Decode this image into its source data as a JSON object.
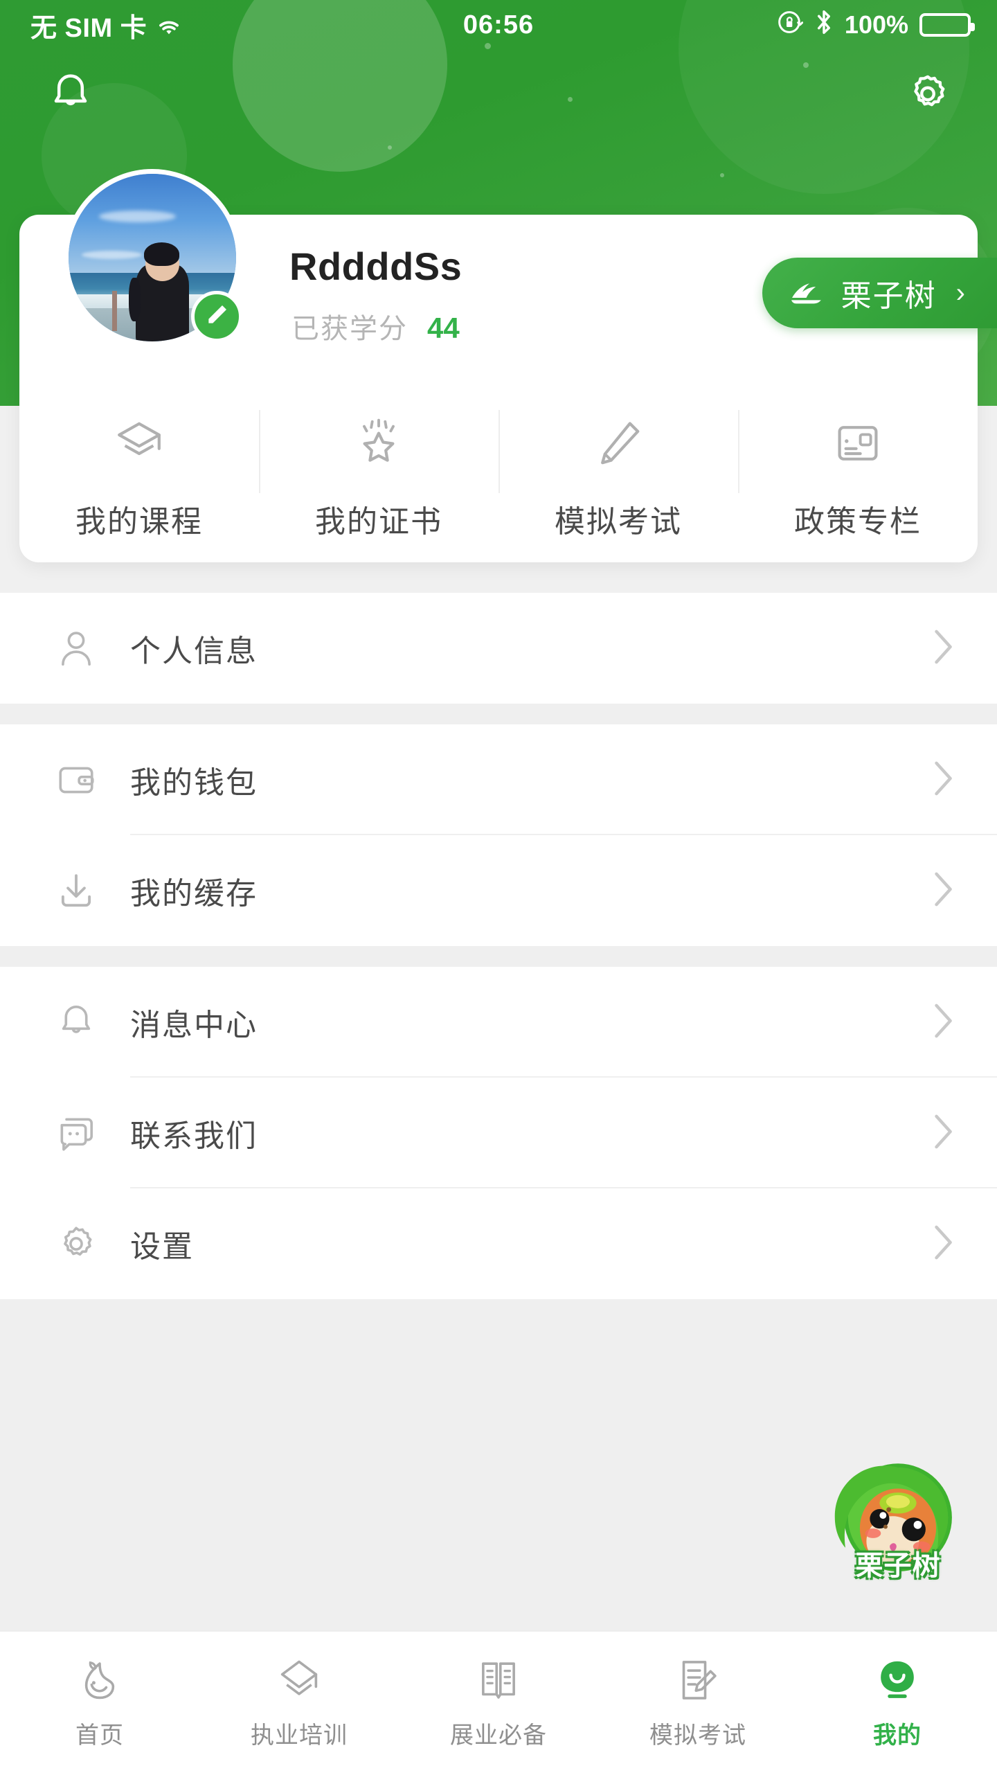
{
  "status_bar": {
    "carrier": "无 SIM 卡",
    "wifi_icon": "wifi-icon",
    "time": "06:56",
    "rotation_lock_icon": "rotation-lock-icon",
    "bluetooth_icon": "bluetooth-icon",
    "battery_percent": "100%",
    "battery_icon": "battery-icon"
  },
  "header": {
    "bell_icon": "bell-icon",
    "gear_icon": "gear-icon",
    "accent_color": "#2f9b33"
  },
  "profile": {
    "avatar_icon": "avatar",
    "edit_icon": "pencil-edit-icon",
    "name": "RddddSs",
    "credit_label": "已获学分",
    "credit_value": "44",
    "tree_button": {
      "icon": "chestnut-tree-icon",
      "label": "栗子树",
      "chevron": "›"
    }
  },
  "quick_actions": [
    {
      "icon": "graduation-cap-icon",
      "label": "我的课程"
    },
    {
      "icon": "star-badge-icon",
      "label": "我的证书"
    },
    {
      "icon": "pencil-icon",
      "label": "模拟考试"
    },
    {
      "icon": "id-card-icon",
      "label": "政策专栏"
    }
  ],
  "menu_groups": [
    {
      "items": [
        {
          "icon": "user-icon",
          "label": "个人信息",
          "chevron": "›"
        }
      ]
    },
    {
      "items": [
        {
          "icon": "wallet-icon",
          "label": "我的钱包",
          "chevron": "›"
        },
        {
          "icon": "download-icon",
          "label": "我的缓存",
          "chevron": "›"
        }
      ]
    },
    {
      "items": [
        {
          "icon": "bell-icon",
          "label": "消息中心",
          "chevron": "›"
        },
        {
          "icon": "chat-icon",
          "label": "联系我们",
          "chevron": "›"
        },
        {
          "icon": "gear-icon",
          "label": "设置",
          "chevron": "›"
        }
      ]
    }
  ],
  "mascot": {
    "icon": "chestnut-mascot-icon",
    "label": "栗子树"
  },
  "bottom_nav": {
    "items": [
      {
        "icon": "home-sprout-icon",
        "label": "首页",
        "active": false
      },
      {
        "icon": "graduation-cap-icon",
        "label": "执业培训",
        "active": false
      },
      {
        "icon": "book-open-icon",
        "label": "展业必备",
        "active": false
      },
      {
        "icon": "exam-pencil-icon",
        "label": "模拟考试",
        "active": false
      },
      {
        "icon": "smiley-profile-icon",
        "label": "我的",
        "active": true
      }
    ],
    "active_color": "#32b14a"
  }
}
